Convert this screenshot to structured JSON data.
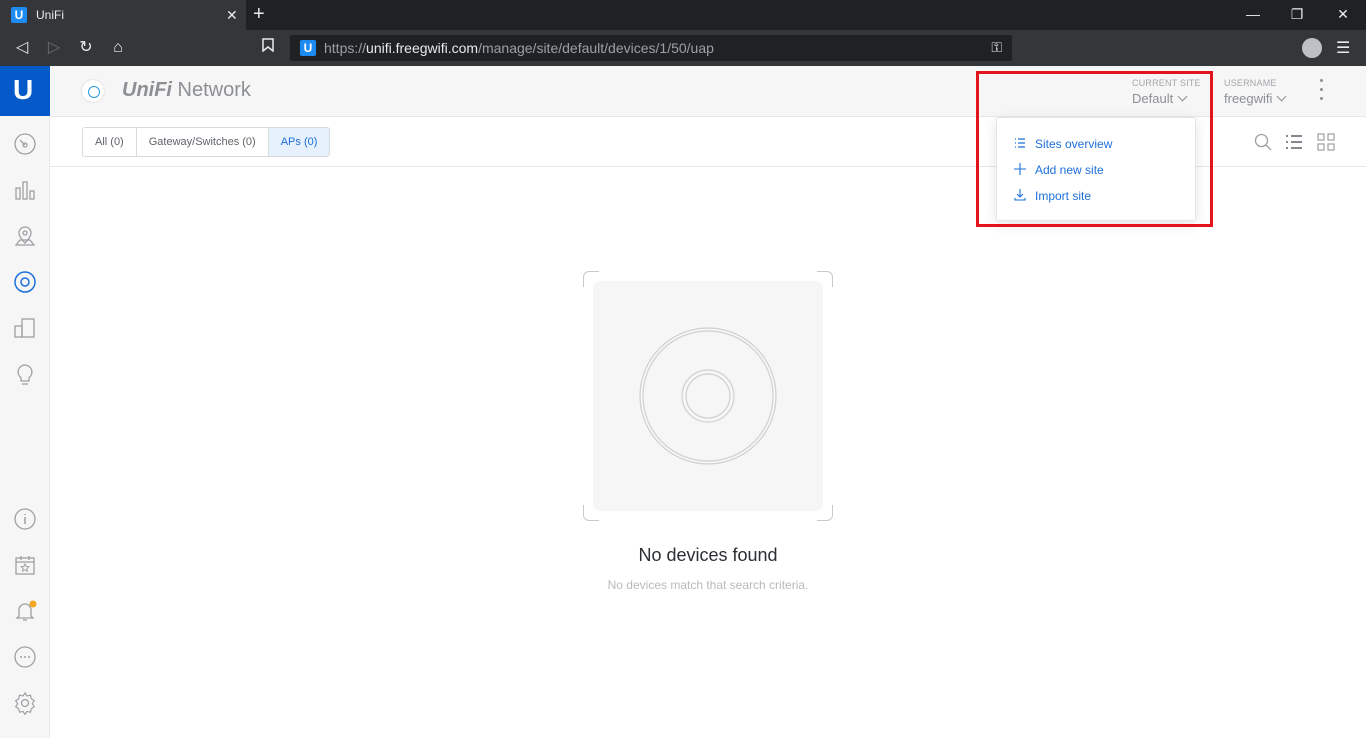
{
  "browser": {
    "tab_title": "UniFi",
    "tab_favicon": "U",
    "url_scheme": "https://",
    "url_host": "unifi.freegwifi.com",
    "url_path": "/manage/site/default/devices/1/50/uap"
  },
  "sidebar": {
    "logo": "U",
    "items": [
      "dashboard-icon",
      "statistics-icon",
      "map-icon",
      "devices-icon",
      "clients-icon",
      "insights-icon"
    ],
    "bottom_items": [
      "info-icon",
      "events-icon",
      "alerts-icon",
      "chat-icon",
      "settings-icon"
    ],
    "alert_dot_color": "#f5a623"
  },
  "header": {
    "brand_prefix": "UniFi",
    "brand_suffix": " Network",
    "current_site_label": "CURRENT SITE",
    "current_site_value": "Default",
    "username_label": "USERNAME",
    "username_value": "freegwifi"
  },
  "filters": {
    "all": "All (0)",
    "gateway": "Gateway/Switches (0)",
    "aps": "APs (0)"
  },
  "site_menu": {
    "items": [
      {
        "label": "Sites overview",
        "icon": "list-icon"
      },
      {
        "label": "Add new site",
        "icon": "plus-icon"
      },
      {
        "label": "Import site",
        "icon": "download-icon"
      }
    ]
  },
  "empty_state": {
    "title": "No devices found",
    "subtitle": "No devices match that search criteria."
  },
  "colors": {
    "accent": "#1d6fd9",
    "brand_blue": "#0559c9",
    "highlight": "#e3141e"
  }
}
